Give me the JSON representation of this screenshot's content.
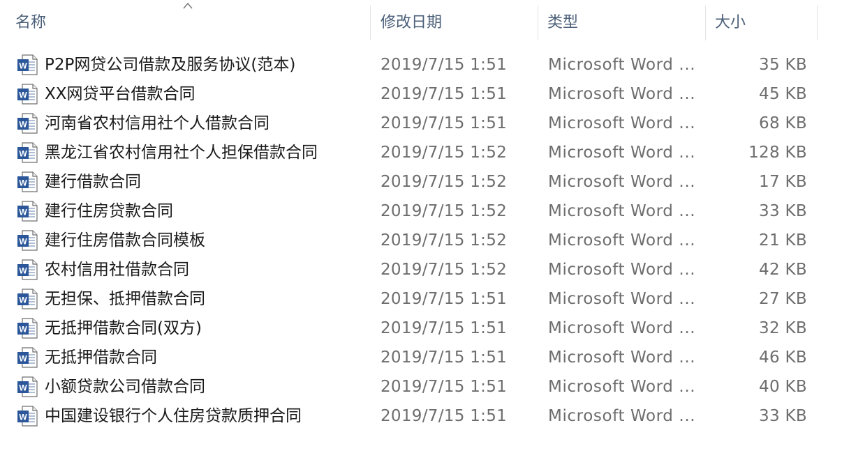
{
  "columns": {
    "name": "名称",
    "date": "修改日期",
    "type": "类型",
    "size": "大小"
  },
  "sort": {
    "column": "name",
    "direction": "ascending",
    "icon": "sort-up-arrow-icon"
  },
  "file_icon": "word-document-icon",
  "colors": {
    "header_text": "#4c607a",
    "meta_text": "#6d6d6d",
    "word_blue": "#2b579a"
  },
  "files": [
    {
      "name": "P2P网贷公司借款及服务协议(范本)",
      "date": "2019/7/15 1:51",
      "type": "Microsoft Word ...",
      "size": "35 KB"
    },
    {
      "name": "XX网贷平台借款合同",
      "date": "2019/7/15 1:51",
      "type": "Microsoft Word ...",
      "size": "45 KB"
    },
    {
      "name": "河南省农村信用社个人借款合同",
      "date": "2019/7/15 1:51",
      "type": "Microsoft Word ...",
      "size": "68 KB"
    },
    {
      "name": "黑龙江省农村信用社个人担保借款合同",
      "date": "2019/7/15 1:52",
      "type": "Microsoft Word ...",
      "size": "128 KB"
    },
    {
      "name": "建行借款合同",
      "date": "2019/7/15 1:52",
      "type": "Microsoft Word ...",
      "size": "17 KB"
    },
    {
      "name": "建行住房贷款合同",
      "date": "2019/7/15 1:52",
      "type": "Microsoft Word ...",
      "size": "33 KB"
    },
    {
      "name": "建行住房借款合同模板",
      "date": "2019/7/15 1:52",
      "type": "Microsoft Word ...",
      "size": "21 KB"
    },
    {
      "name": "农村信用社借款合同",
      "date": "2019/7/15 1:52",
      "type": "Microsoft Word ...",
      "size": "42 KB"
    },
    {
      "name": "无担保、抵押借款合同",
      "date": "2019/7/15 1:51",
      "type": "Microsoft Word ...",
      "size": "27 KB"
    },
    {
      "name": "无抵押借款合同(双方)",
      "date": "2019/7/15 1:51",
      "type": "Microsoft Word ...",
      "size": "32 KB"
    },
    {
      "name": "无抵押借款合同",
      "date": "2019/7/15 1:51",
      "type": "Microsoft Word ...",
      "size": "46 KB"
    },
    {
      "name": "小额贷款公司借款合同",
      "date": "2019/7/15 1:51",
      "type": "Microsoft Word ...",
      "size": "40 KB"
    },
    {
      "name": "中国建设银行个人住房贷款质押合同",
      "date": "2019/7/15 1:51",
      "type": "Microsoft Word ...",
      "size": "33 KB"
    }
  ]
}
